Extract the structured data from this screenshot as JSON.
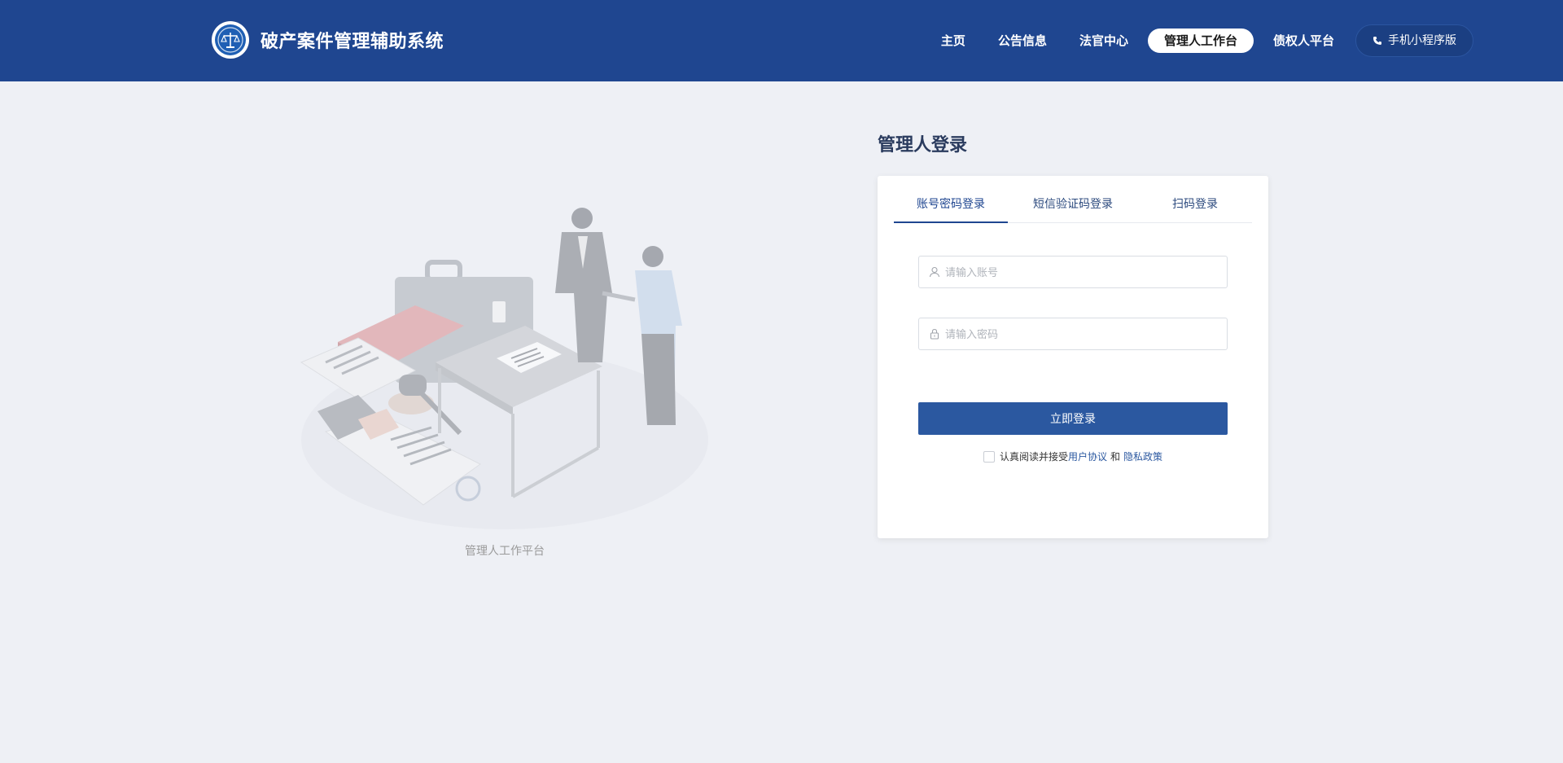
{
  "header": {
    "title": "破产案件管理辅助系统",
    "nav": [
      {
        "label": "主页",
        "active": false
      },
      {
        "label": "公告信息",
        "active": false
      },
      {
        "label": "法官中心",
        "active": false
      },
      {
        "label": "管理人工作台",
        "active": true
      },
      {
        "label": "债权人平台",
        "active": false
      }
    ],
    "mini_program_label": "手机小程序版"
  },
  "illustration": {
    "caption": "管理人工作平台"
  },
  "login": {
    "title": "管理人登录",
    "tabs": [
      {
        "label": "账号密码登录",
        "active": true
      },
      {
        "label": "短信验证码登录",
        "active": false
      },
      {
        "label": "扫码登录",
        "active": false
      }
    ],
    "account_placeholder": "请输入账号",
    "password_placeholder": "请输入密码",
    "submit_label": "立即登录",
    "agreement_prefix": "认真阅读并接受",
    "user_agreement": "用户协议",
    "and_text": "和",
    "privacy_policy": "隐私政策"
  },
  "colors": {
    "header_bg": "#1f4690",
    "primary": "#2b58a0",
    "page_bg": "#eef0f5"
  }
}
